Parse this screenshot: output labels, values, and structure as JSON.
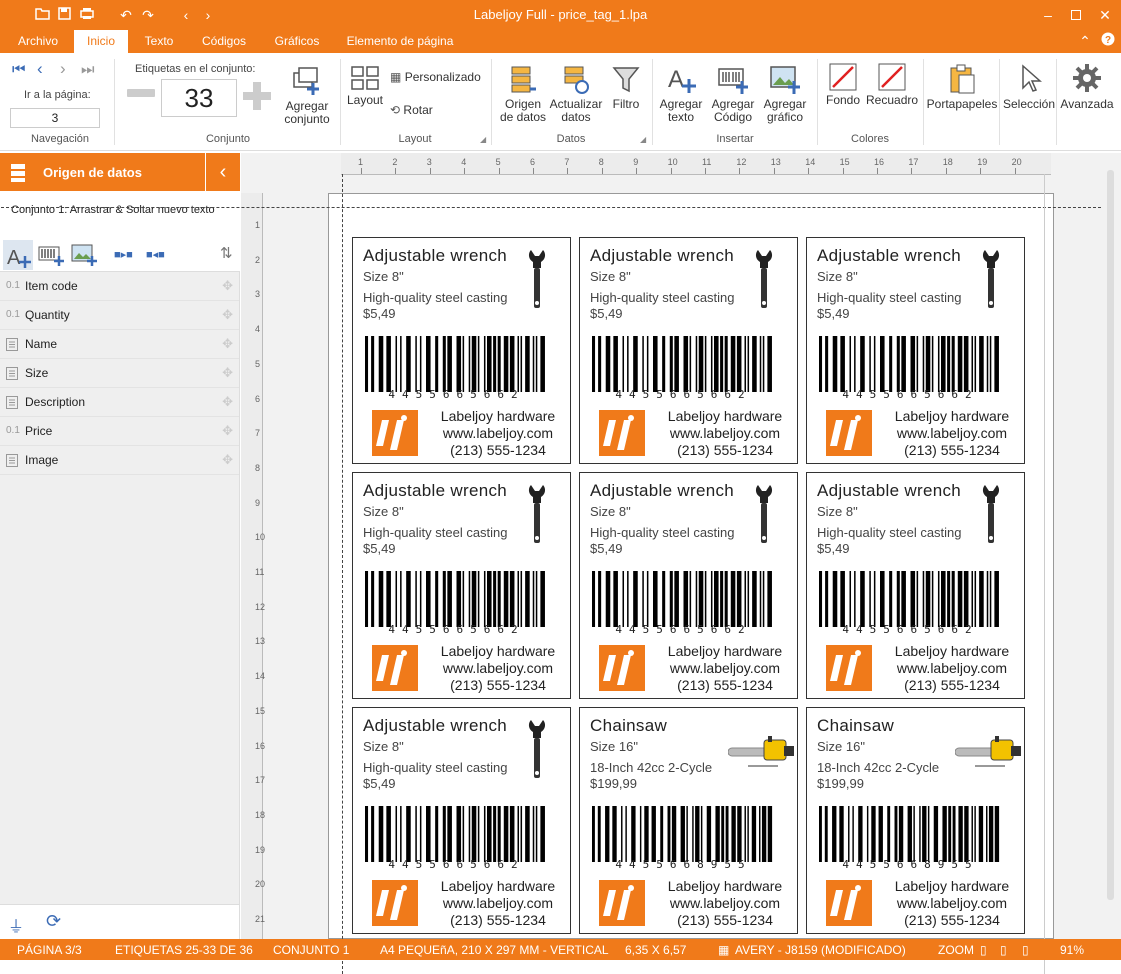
{
  "titlebar": {
    "title": "Labeljoy Full - price_tag_1.lpa"
  },
  "menu": {
    "tabs": [
      "Archivo",
      "Inicio",
      "Texto",
      "Códigos",
      "Gráficos",
      "Elemento de página"
    ],
    "active": "Inicio"
  },
  "ribbon": {
    "nav": {
      "goto_label": "Ir a la página:",
      "page_value": "3",
      "group": "Navegación"
    },
    "set": {
      "labels_label": "Etiquetas en el conjunto:",
      "count": "33",
      "add_set": "Agregar conjunto",
      "group": "Conjunto"
    },
    "layout": {
      "layout_btn": "Layout",
      "custom": "Personalizado",
      "rotate": "Rotar",
      "group": "Layout"
    },
    "data": {
      "source": "Origen de datos",
      "update": "Actualizar datos",
      "filter": "Filtro",
      "group": "Datos"
    },
    "insert": {
      "add_text": "Agregar texto",
      "add_code": "Agregar Código",
      "add_graphic": "Agregar gráfico",
      "group": "Insertar"
    },
    "colors": {
      "background": "Fondo",
      "border": "Recuadro",
      "group": "Colores"
    },
    "other": {
      "clipboard": "Portapapeles",
      "selection": "Selección",
      "advanced": "Avanzada"
    }
  },
  "left_panel": {
    "title": "Origen de datos",
    "subtitle": "Conjunto 1: Arrastrar & Soltar nuevo texto",
    "fields": [
      {
        "type": "0.1",
        "name": "Item code"
      },
      {
        "type": "0.1",
        "name": "Quantity"
      },
      {
        "type": "doc",
        "name": "Name"
      },
      {
        "type": "doc",
        "name": "Size"
      },
      {
        "type": "doc",
        "name": "Description"
      },
      {
        "type": "0.1",
        "name": "Price"
      },
      {
        "type": "doc",
        "name": "Image"
      }
    ]
  },
  "rulers": {
    "h": [
      "1",
      "2",
      "3",
      "4",
      "5",
      "6",
      "7",
      "8",
      "9",
      "10",
      "11",
      "12",
      "13",
      "14",
      "15",
      "16",
      "17",
      "18",
      "19",
      "20"
    ],
    "v": [
      "1",
      "2",
      "3",
      "4",
      "5",
      "6",
      "7",
      "8",
      "9",
      "10",
      "11",
      "12",
      "13",
      "14",
      "15",
      "16",
      "17",
      "18",
      "19",
      "20",
      "21"
    ]
  },
  "labels": [
    {
      "name": "Adjustable wrench",
      "size": "Size 8\"",
      "desc": "High-quality steel casting",
      "price": "$5,49",
      "barcode": "4455665662",
      "image": "wrench"
    },
    {
      "name": "Adjustable wrench",
      "size": "Size 8\"",
      "desc": "High-quality steel casting",
      "price": "$5,49",
      "barcode": "4455665662",
      "image": "wrench"
    },
    {
      "name": "Adjustable wrench",
      "size": "Size 8\"",
      "desc": "High-quality steel casting",
      "price": "$5,49",
      "barcode": "4455665662",
      "image": "wrench"
    },
    {
      "name": "Adjustable wrench",
      "size": "Size 8\"",
      "desc": "High-quality steel casting",
      "price": "$5,49",
      "barcode": "4455665662",
      "image": "wrench"
    },
    {
      "name": "Adjustable wrench",
      "size": "Size 8\"",
      "desc": "High-quality steel casting",
      "price": "$5,49",
      "barcode": "4455665662",
      "image": "wrench"
    },
    {
      "name": "Adjustable wrench",
      "size": "Size 8\"",
      "desc": "High-quality steel casting",
      "price": "$5,49",
      "barcode": "4455665662",
      "image": "wrench"
    },
    {
      "name": "Adjustable wrench",
      "size": "Size 8\"",
      "desc": "High-quality steel casting",
      "price": "$5,49",
      "barcode": "4455665662",
      "image": "wrench"
    },
    {
      "name": "Chainsaw",
      "size": "Size 16\"",
      "desc": "18-Inch 42cc 2-Cycle",
      "price": "$199,99",
      "barcode": "4455668955",
      "image": "chainsaw"
    },
    {
      "name": "Chainsaw",
      "size": "Size 16\"",
      "desc": "18-Inch 42cc 2-Cycle",
      "price": "$199,99",
      "barcode": "4455668955",
      "image": "chainsaw"
    }
  ],
  "company": {
    "line1": "Labeljoy hardware",
    "line2": "www.labeljoy.com",
    "line3": "(213) 555-1234"
  },
  "status": {
    "page": "PÁGINA 3/3",
    "labels": "ETIQUETAS 25-33 DE 36",
    "set": "CONJUNTO 1",
    "paper": "A4 PEQUEñA, 210 X 297 MM - VERTICAL",
    "size": "6,35 X 6,57",
    "template": "AVERY - J8159 (MODIFICADO)",
    "zoom_label": "ZOOM",
    "zoom": "91%"
  },
  "colors": {
    "accent": "#f07a1a"
  }
}
